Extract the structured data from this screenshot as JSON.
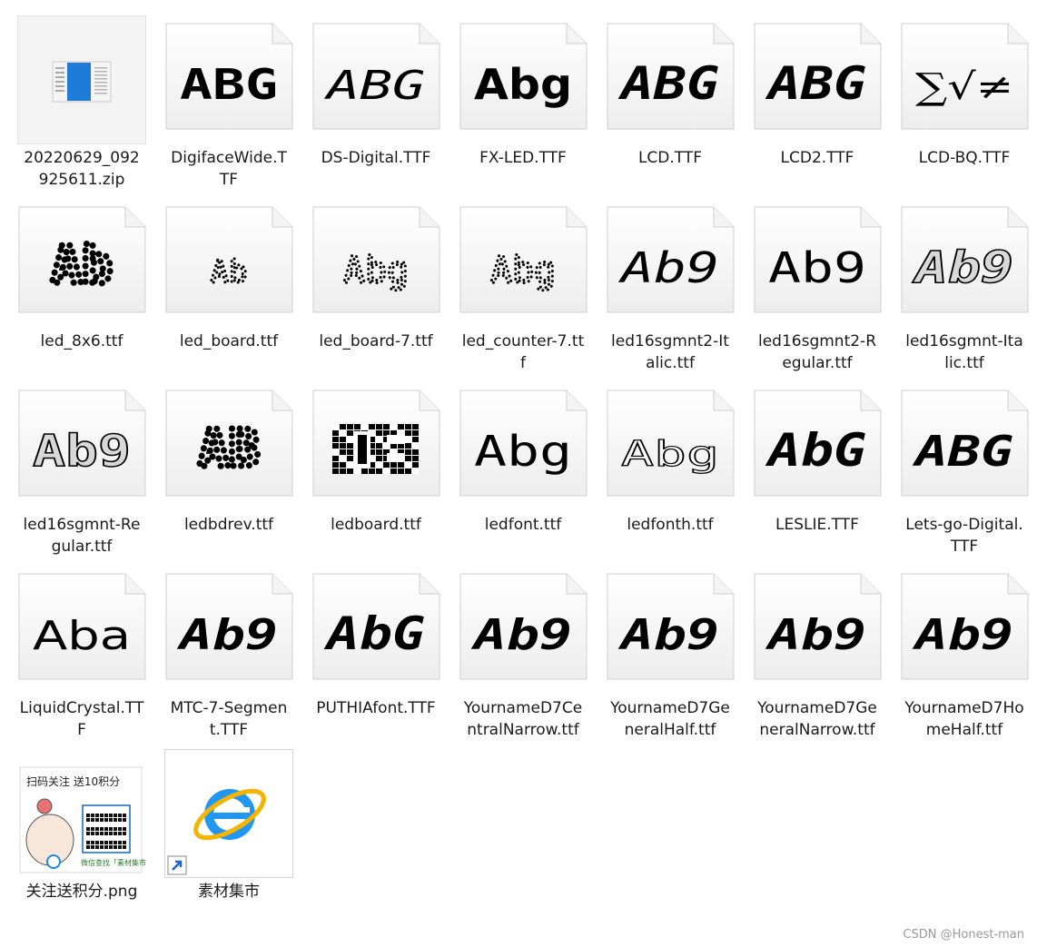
{
  "files": [
    {
      "name": "20220629_092925611.zip",
      "label": "20220629_092\n925611.zip",
      "kind": "zip",
      "selected": true
    },
    {
      "name": "DigifaceWide.TTF",
      "label": "DigifaceWide.T\nTF",
      "kind": "font",
      "preview": "ABG",
      "style": "wide"
    },
    {
      "name": "DS-Digital.TTF",
      "label": "DS-Digital.TTF",
      "kind": "font",
      "preview": "ABG",
      "style": "seg"
    },
    {
      "name": "FX-LED.TTF",
      "label": "FX-LED.TTF",
      "kind": "font",
      "preview": "Abg",
      "style": "fx"
    },
    {
      "name": "LCD.TTF",
      "label": "LCD.TTF",
      "kind": "font",
      "preview": "ABG",
      "style": "lcd"
    },
    {
      "name": "LCD2.TTF",
      "label": "LCD2.TTF",
      "kind": "font",
      "preview": "ABG",
      "style": "lcd"
    },
    {
      "name": "LCD-BQ.TTF",
      "label": "LCD-BQ.TTF",
      "kind": "font",
      "preview": "∑√≠",
      "style": "math"
    },
    {
      "name": "led_8x6.ttf",
      "label": "led_8x6.ttf",
      "kind": "font",
      "preview": "Ab",
      "style": "dots-big"
    },
    {
      "name": "led_board.ttf",
      "label": "led_board.ttf",
      "kind": "font",
      "preview": "Ab",
      "style": "dots-small"
    },
    {
      "name": "led_board-7.ttf",
      "label": "led_board-7.ttf",
      "kind": "font",
      "preview": "Abg",
      "style": "dots-mid"
    },
    {
      "name": "led_counter-7.ttf",
      "label": "led_counter-7.tt\nf",
      "kind": "font",
      "preview": "Abg",
      "style": "dots-mid"
    },
    {
      "name": "led16sgmnt2-Italic.ttf",
      "label": "led16sgmnt2-It\nalic.ttf",
      "kind": "font",
      "preview": "Ab9",
      "style": "thin-italic"
    },
    {
      "name": "led16sgmnt2-Regular.ttf",
      "label": "led16sgmnt2-R\negular.ttf",
      "kind": "font",
      "preview": "Ab9",
      "style": "thin"
    },
    {
      "name": "led16sgmnt-Italic.ttf",
      "label": "led16sgmnt-Ita\nlic.ttf",
      "kind": "font",
      "preview": "Ab9",
      "style": "outline-italic"
    },
    {
      "name": "led16sgmnt-Regular.ttf",
      "label": "led16sgmnt-Re\ngular.ttf",
      "kind": "font",
      "preview": "Ab9",
      "style": "outline"
    },
    {
      "name": "ledbdrev.ttf",
      "label": "ledbdrev.ttf",
      "kind": "font",
      "preview": "AB",
      "style": "dots-big"
    },
    {
      "name": "ledboard.ttf",
      "label": "ledboard.ttf",
      "kind": "font",
      "preview": "",
      "style": "block"
    },
    {
      "name": "ledfont.ttf",
      "label": "ledfont.ttf",
      "kind": "font",
      "preview": "Abg",
      "style": "thin"
    },
    {
      "name": "ledfonth.ttf",
      "label": "ledfonth.ttf",
      "kind": "font",
      "preview": "Abg",
      "style": "hollow"
    },
    {
      "name": "LESLIE.TTF",
      "label": "LESLIE.TTF",
      "kind": "font",
      "preview": "AbG",
      "style": "lcd"
    },
    {
      "name": "Lets-go-Digital.TTF",
      "label": "Lets-go-Digital.\nTTF",
      "kind": "font",
      "preview": "ABG",
      "style": "seg-bold"
    },
    {
      "name": "LiquidCrystal.TTF",
      "label": "LiquidCrystal.TT\nF",
      "kind": "font",
      "preview": "Aba",
      "style": "liquid"
    },
    {
      "name": "MTC-7-Segment.TTF",
      "label": "MTC-7-Segmen\nt.TTF",
      "kind": "font",
      "preview": "Ab9",
      "style": "seg-bold"
    },
    {
      "name": "PUTHIAfont.TTF",
      "label": "PUTHIAfont.TTF",
      "kind": "font",
      "preview": "AbG",
      "style": "lcd"
    },
    {
      "name": "YournameD7CentralNarrow.ttf",
      "label": "YournameD7Ce\nntralNarrow.ttf",
      "kind": "font",
      "preview": "Ab9",
      "style": "seg-bold"
    },
    {
      "name": "YournameD7GeneralHalf.ttf",
      "label": "YournameD7Ge\nneralHalf.ttf",
      "kind": "font",
      "preview": "Ab9",
      "style": "seg-bold"
    },
    {
      "name": "YournameD7GeneralNarrow.ttf",
      "label": "YournameD7Ge\nneralNarrow.ttf",
      "kind": "font",
      "preview": "Ab9",
      "style": "seg-bold"
    },
    {
      "name": "YournameD7HomeHalf.ttf",
      "label": "YournameD7Ho\nmeHalf.ttf",
      "kind": "font",
      "preview": "Ab9",
      "style": "seg-bold"
    },
    {
      "name": "关注送积分.png",
      "label": "关注送积分.png",
      "kind": "png",
      "img_text_top": "扫码关注 送10积分",
      "img_text_bottom": "微信查找「素材集市」"
    },
    {
      "name": "素材集市",
      "label": "素材集市",
      "kind": "shortcut",
      "icon": "internet-explorer-icon"
    }
  ],
  "watermark": "CSDN @Honest-man"
}
